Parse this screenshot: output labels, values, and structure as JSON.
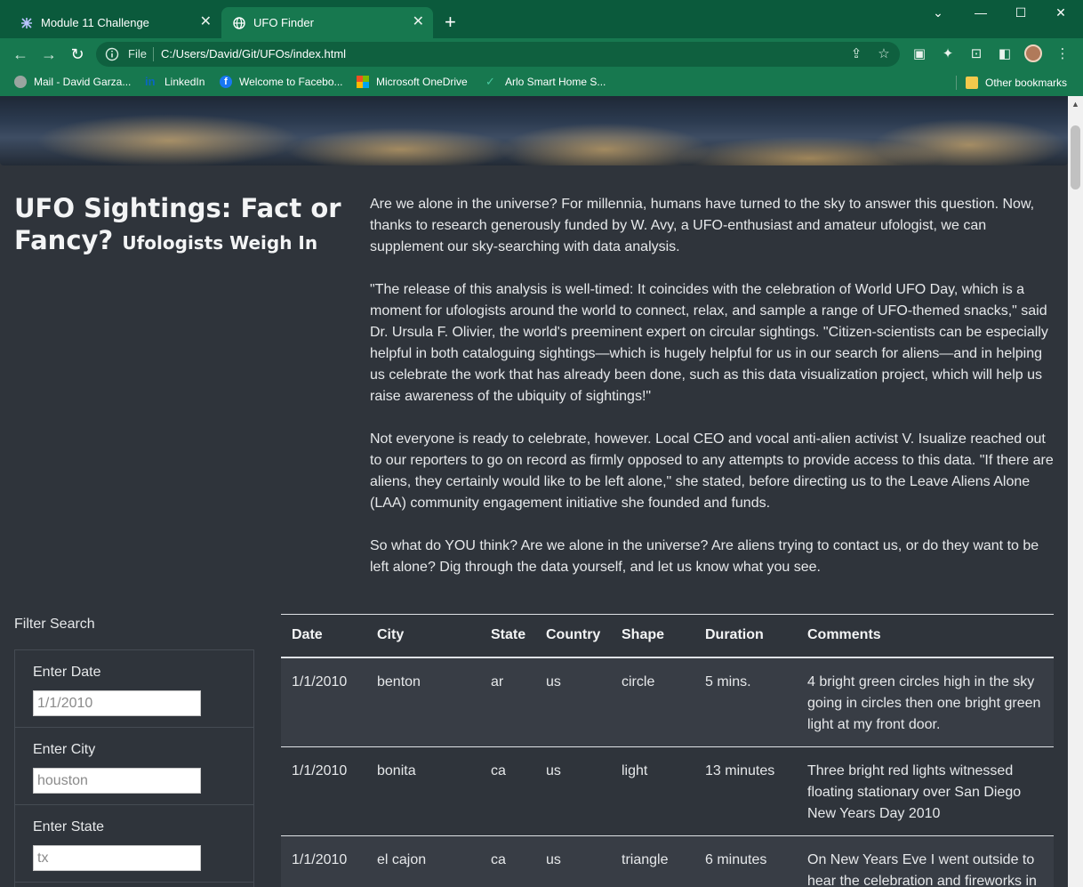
{
  "browser": {
    "tabs": [
      {
        "label": "Module 11 Challenge",
        "active": false
      },
      {
        "label": "UFO Finder",
        "active": true
      }
    ],
    "address": {
      "scheme_label": "File",
      "url": "C:/Users/David/Git/UFOs/index.html"
    },
    "bookmarks": [
      {
        "label": "Mail - David Garza..."
      },
      {
        "label": "LinkedIn"
      },
      {
        "label": "Welcome to Facebo..."
      },
      {
        "label": "Microsoft OneDrive"
      },
      {
        "label": "Arlo Smart Home S..."
      }
    ],
    "other_bookmarks": "Other bookmarks",
    "colors": {
      "titlebar": "#0b5a3c",
      "toolbar": "#17784f"
    }
  },
  "page": {
    "title_main": "UFO Sightings: Fact or Fancy?",
    "title_sub": "Ufologists Weigh In",
    "paragraphs": [
      "Are we alone in the universe? For millennia, humans have turned to the sky to answer this question. Now, thanks to research generously funded by W. Avy, a UFO-enthusiast and amateur ufologist, we can supplement our sky-searching with data analysis.",
      "\"The release of this analysis is well-timed: It coincides with the celebration of World UFO Day, which is a moment for ufologists around the world to connect, relax, and sample a range of UFO-themed snacks,\" said Dr. Ursula F. Olivier, the world's preeminent expert on circular sightings. \"Citizen-scientists can be especially helpful in both cataloguing sightings—which is hugely helpful for us in our search for aliens—and in helping us celebrate the work that has already been done, such as this data visualization project, which will help us raise awareness of the ubiquity of sightings!\"",
      "Not everyone is ready to celebrate, however. Local CEO and vocal anti-alien activist V. Isualize reached out to our reporters to go on record as firmly opposed to any attempts to provide access to this data. \"If there are aliens, they certainly would like to be left alone,\" she stated, before directing us to the Leave Aliens Alone (LAA) community engagement initiative she founded and funds.",
      "So what do YOU think? Are we alone in the universe? Are aliens trying to contact us, or do they want to be left alone? Dig through the data yourself, and let us know what you see."
    ],
    "filter": {
      "title": "Filter Search",
      "fields": [
        {
          "label": "Enter Date",
          "placeholder": "1/1/2010"
        },
        {
          "label": "Enter City",
          "placeholder": "houston"
        },
        {
          "label": "Enter State",
          "placeholder": "tx"
        }
      ]
    },
    "table": {
      "headers": [
        "Date",
        "City",
        "State",
        "Country",
        "Shape",
        "Duration",
        "Comments"
      ],
      "rows": [
        [
          "1/1/2010",
          "benton",
          "ar",
          "us",
          "circle",
          "5 mins.",
          "4 bright green circles high in the sky going in circles then one bright green light at my front door."
        ],
        [
          "1/1/2010",
          "bonita",
          "ca",
          "us",
          "light",
          "13 minutes",
          "Three bright red lights witnessed floating stationary over San Diego New Years Day 2010"
        ],
        [
          "1/1/2010",
          "el cajon",
          "ca",
          "us",
          "triangle",
          "6 minutes",
          "On New Years Eve I went outside to hear the celebration and fireworks in"
        ]
      ]
    }
  }
}
